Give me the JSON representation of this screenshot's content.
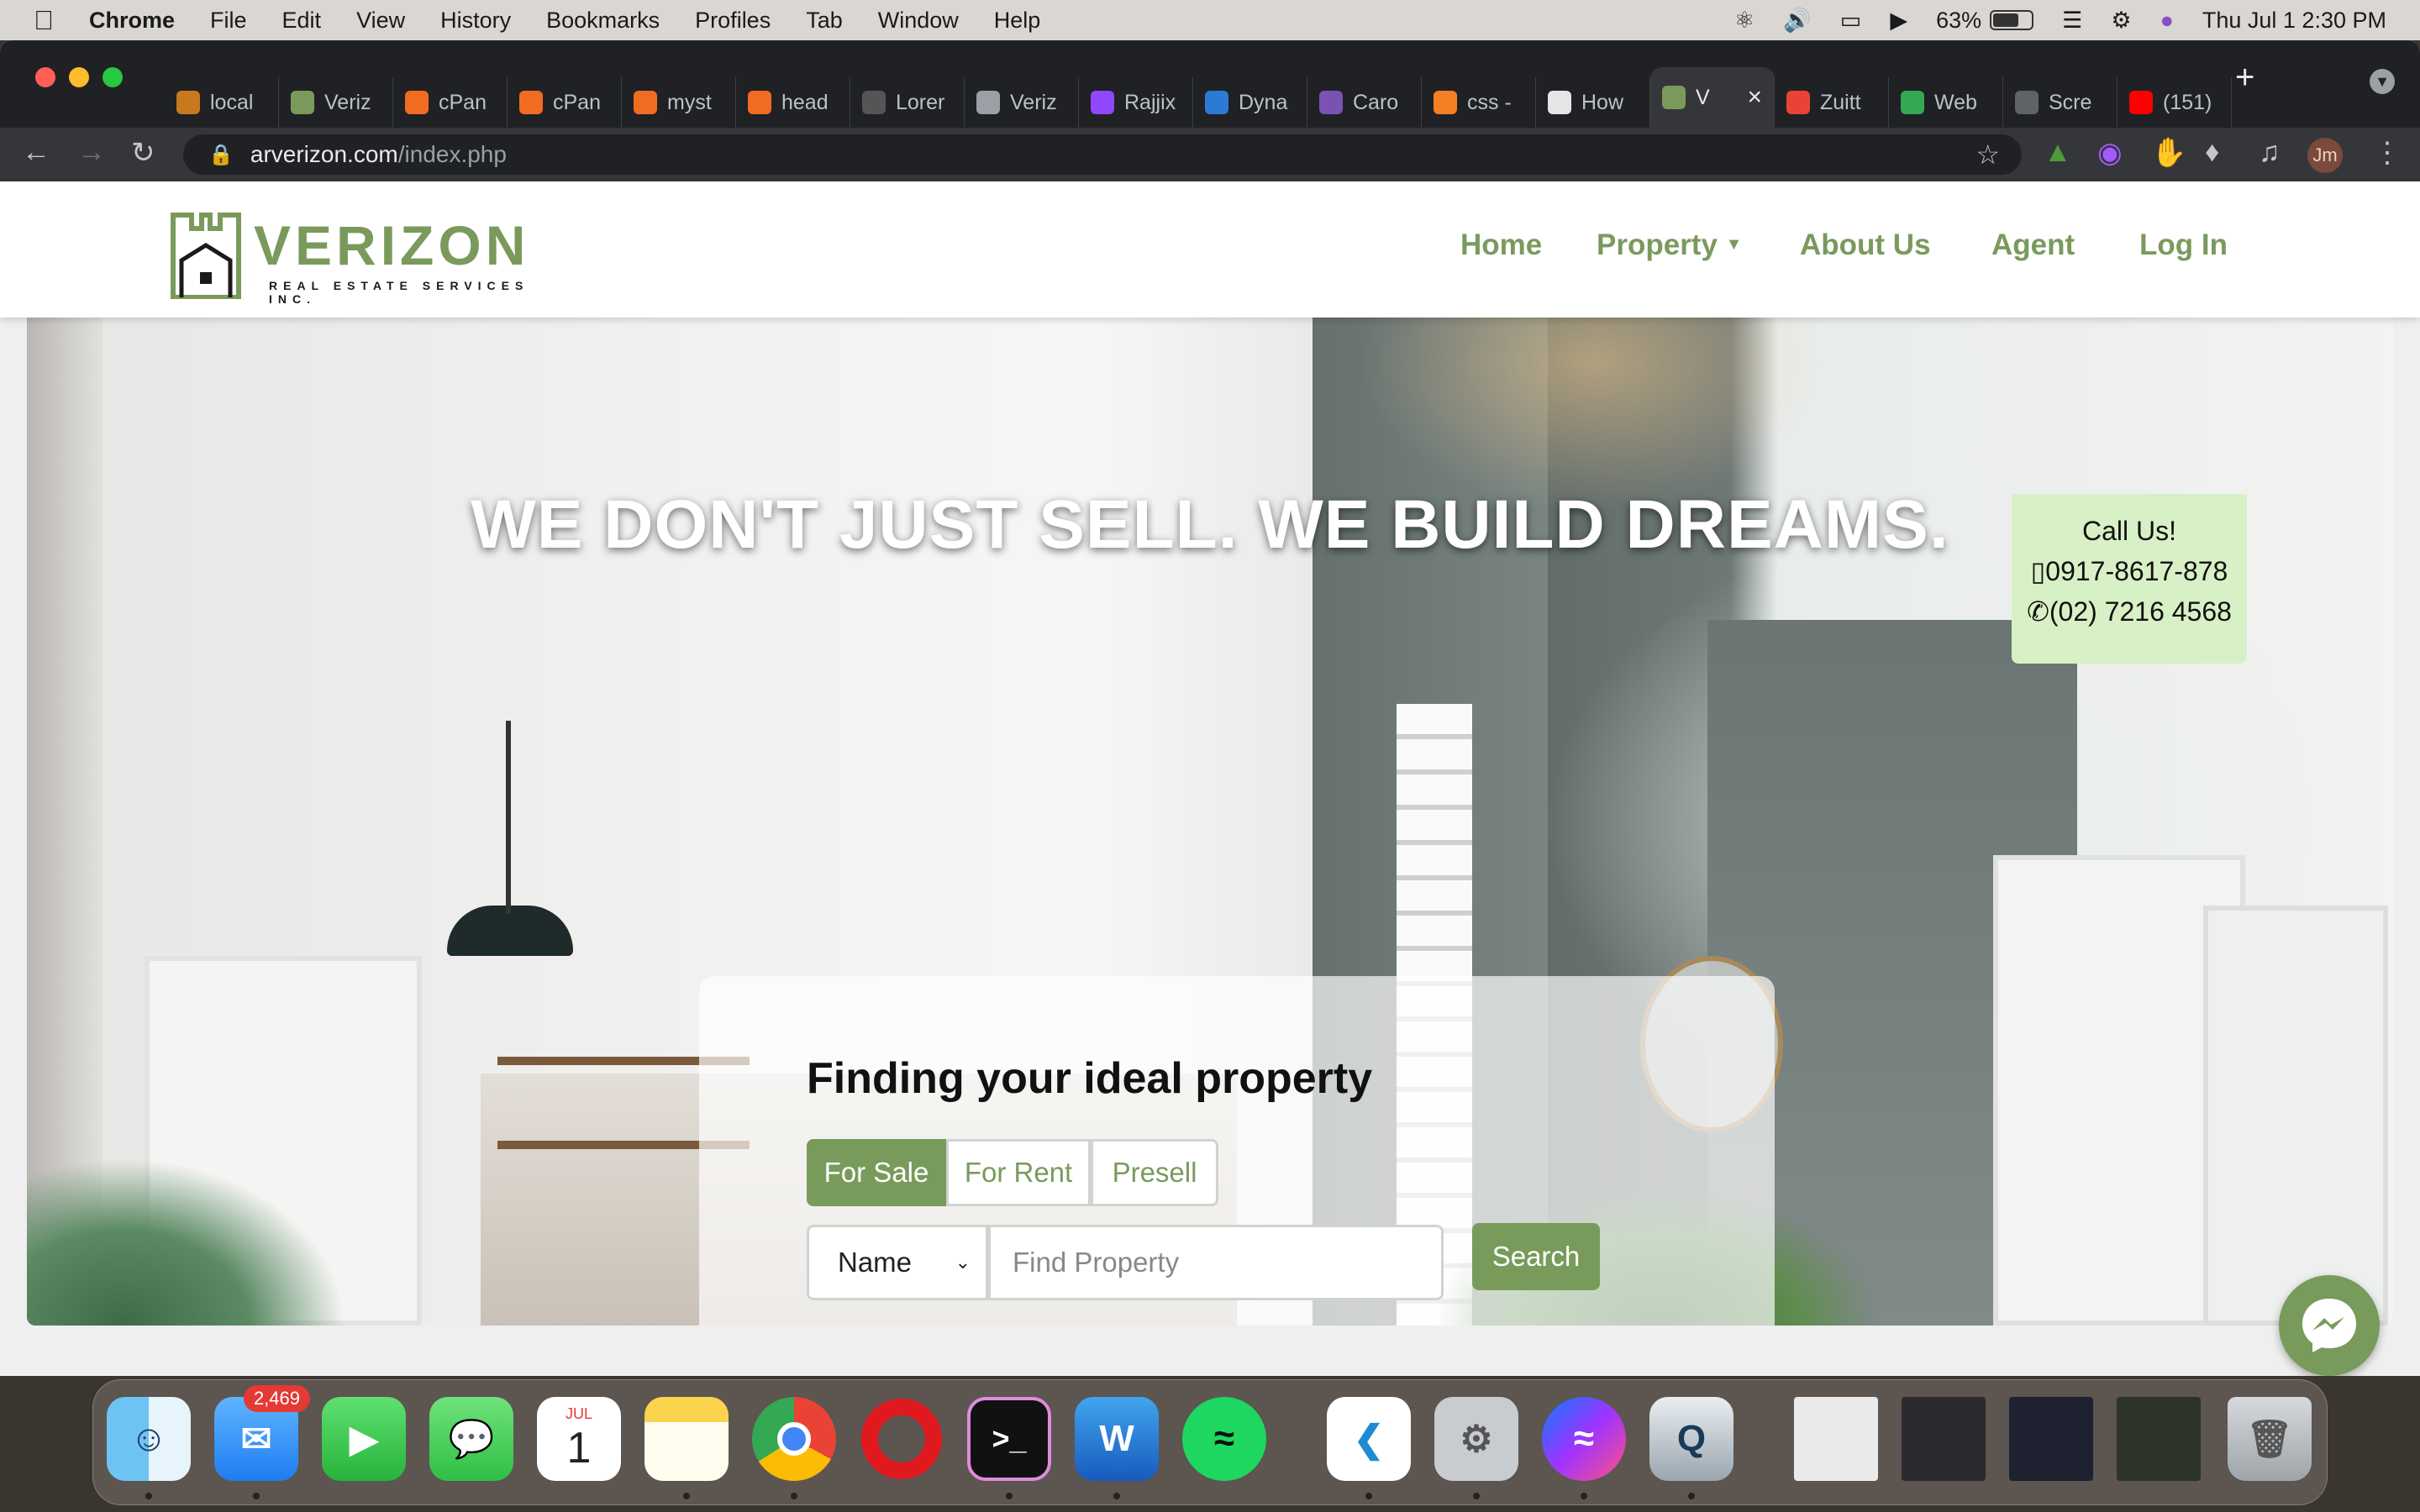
{
  "menubar": {
    "app_name": "Chrome",
    "menus": [
      "File",
      "Edit",
      "View",
      "History",
      "Bookmarks",
      "Profiles",
      "Tab",
      "Window",
      "Help"
    ],
    "battery": "63%",
    "datetime": "Thu Jul 1  2:30 PM"
  },
  "browser": {
    "tabs": [
      {
        "label": "local",
        "color": "#c8781e"
      },
      {
        "label": "Veriz",
        "color": "#7a9a5c"
      },
      {
        "label": "cPan",
        "color": "#f26b22"
      },
      {
        "label": "cPan",
        "color": "#f26b22"
      },
      {
        "label": "myst",
        "color": "#f26b22"
      },
      {
        "label": "head",
        "color": "#f26b22"
      },
      {
        "label": "Lorer",
        "color": "#555555"
      },
      {
        "label": "Veriz",
        "color": "#9aa0a6"
      },
      {
        "label": "Rajjix",
        "color": "#9146ff"
      },
      {
        "label": "Dyna",
        "color": "#2b7bd6"
      },
      {
        "label": "Caro",
        "color": "#7952b3"
      },
      {
        "label": "css -",
        "color": "#f48024"
      },
      {
        "label": "How",
        "color": "#e6e6e6"
      },
      {
        "label": "V",
        "color": "#7a9a5c",
        "active": true
      },
      {
        "label": "Zuitt",
        "color": "#ea4335"
      },
      {
        "label": "Web",
        "color": "#34a853"
      },
      {
        "label": "Scre",
        "color": "#5f6368"
      },
      {
        "label": "(151)",
        "color": "#ff0000"
      }
    ],
    "url_host": "arverizon.com",
    "url_path": "/index.php",
    "profile_initials": "Jm"
  },
  "site": {
    "logo": {
      "brand": "VERIZON",
      "tagline": "REAL ESTATE SERVICES INC."
    },
    "nav": {
      "home": "Home",
      "property": "Property",
      "about": "About Us",
      "agent": "Agent",
      "login": "Log In"
    },
    "hero": {
      "headline": "WE DON'T JUST SELL. WE BUILD DREAMS."
    },
    "call": {
      "title": "Call Us!",
      "mobile": "0917-8617-878",
      "landline": "(02) 7216 4568"
    },
    "search": {
      "title": "Finding your ideal property",
      "tabs": [
        "For Sale",
        "For Rent",
        "Presell"
      ],
      "active_tab": "For Sale",
      "field_select": "Name",
      "input_placeholder": "Find Property",
      "button": "Search"
    },
    "accent_color": "#789b5b",
    "call_box_color": "#d8f0c6"
  },
  "dock": {
    "mail_badge": "2,469",
    "calendar_month": "JUL",
    "calendar_day": "1",
    "apps": [
      "finder-icon",
      "mail-icon",
      "facetime-icon",
      "messages-icon",
      "calendar-icon",
      "notes-icon",
      "chrome-icon",
      "opera-icon",
      "terminal-icon",
      "word-icon",
      "spotify-icon",
      "vscode-icon",
      "system-preferences-icon",
      "messenger-icon",
      "quicktime-icon",
      "trash-icon"
    ]
  }
}
